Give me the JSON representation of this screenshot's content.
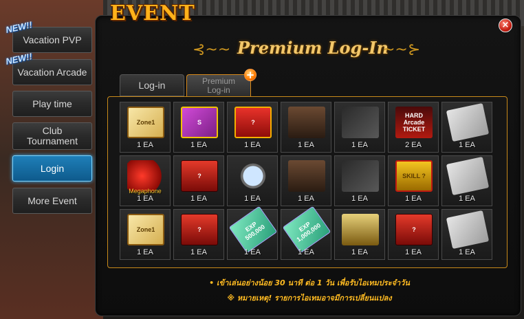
{
  "header": {
    "event_title": "EVENT",
    "close_label": "×",
    "panel_title": "Premium Log-In"
  },
  "sidebar": {
    "items": [
      {
        "label": "Vacation PVP",
        "badge": "NEW!!"
      },
      {
        "label": "Vacation Arcade",
        "badge": "NEW!!"
      },
      {
        "label": "Play time"
      },
      {
        "label": "Club Tournament"
      },
      {
        "label": "Login",
        "active": true
      },
      {
        "label": "More Event"
      }
    ]
  },
  "tabs": [
    {
      "label": "Log-in"
    },
    {
      "label": "Premium Log-in",
      "selected": true
    }
  ],
  "plus_label": "+",
  "rewards": [
    {
      "qty": "1 EA",
      "icon": "zone-ticket-icon",
      "art_text": "Zone1"
    },
    {
      "qty": "1 EA",
      "icon": "purple-box-icon",
      "art_text": "S"
    },
    {
      "qty": "1 EA",
      "icon": "mystery-gift-box-icon",
      "art_text": "?"
    },
    {
      "qty": "1 EA",
      "icon": "character-costume-icon"
    },
    {
      "qty": "1 EA",
      "icon": "weapon-icon"
    },
    {
      "qty": "2 EA",
      "icon": "hard-arcade-ticket-icon",
      "art_text": "HARD Arcade TICKET"
    },
    {
      "qty": "1 EA",
      "icon": "silver-card-icon"
    },
    {
      "qty": "1 EA",
      "icon": "megaphone-icon",
      "label": "Megaphone"
    },
    {
      "qty": "1 EA",
      "icon": "random-box-icon",
      "art_text": "?"
    },
    {
      "qty": "1 EA",
      "icon": "magnifier-icon"
    },
    {
      "qty": "1 EA",
      "icon": "character-costume-icon"
    },
    {
      "qty": "1 EA",
      "icon": "weapon-icon"
    },
    {
      "qty": "1 EA",
      "icon": "skill-box-icon",
      "art_text": "SKILL ?"
    },
    {
      "qty": "1 EA",
      "icon": "silver-card-icon"
    },
    {
      "qty": "1 EA",
      "icon": "zone-ticket-icon",
      "art_text": "Zone1"
    },
    {
      "qty": "1 EA",
      "icon": "random-box-icon",
      "art_text": "?"
    },
    {
      "qty": "1 EA",
      "icon": "exp-card-icon",
      "art_text": "EXP 500,000"
    },
    {
      "qty": "1 EA",
      "icon": "exp-card-icon",
      "art_text": "EXP 1,000,000"
    },
    {
      "qty": "1 EA",
      "icon": "potion-bottle-icon"
    },
    {
      "qty": "1 EA",
      "icon": "random-box-icon",
      "art_text": "?"
    },
    {
      "qty": "1 EA",
      "icon": "silver-card-icon"
    }
  ],
  "footer": {
    "note_1": "• เข้าเล่นอย่างน้อย 30 นาที ต่อ 1 วัน เพื่อรับไอเทมประจำวัน",
    "note_2": "※ หมายเหตุ! รายการไอเทมอาจมีการเปลี่ยนแปลง"
  },
  "colors": {
    "accent": "#ffb21a",
    "active_button": "#1f7fb8",
    "frame_border": "#c98a1a"
  }
}
